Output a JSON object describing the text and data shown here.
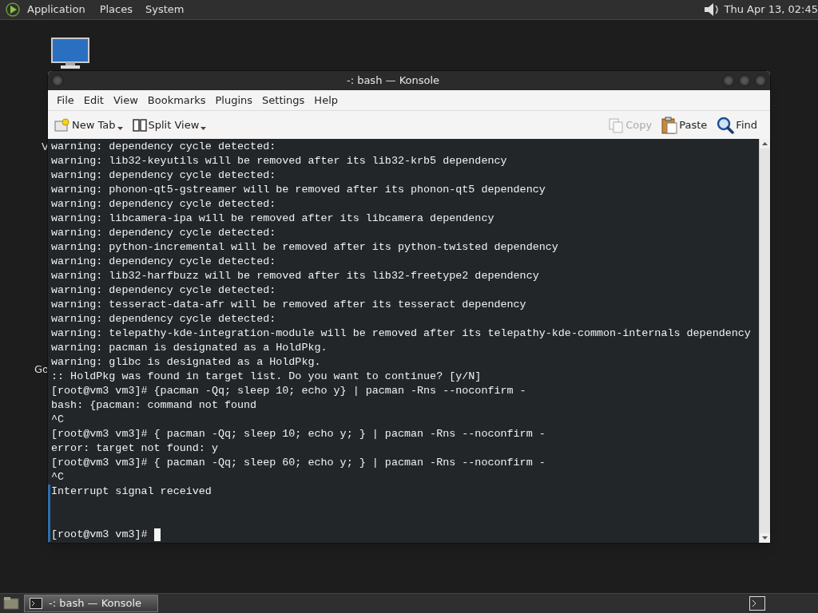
{
  "top_panel": {
    "menus": [
      "Application",
      "Places",
      "System"
    ],
    "clock": "Thu Apr 13, 02:45"
  },
  "desktop_icons": [
    {
      "label": "V"
    },
    {
      "label": "Go"
    }
  ],
  "window": {
    "title": "-: bash — Konsole",
    "menu": [
      "File",
      "Edit",
      "View",
      "Bookmarks",
      "Plugins",
      "Settings",
      "Help"
    ],
    "toolbar": [
      {
        "kind": "newtab",
        "label": "New Tab",
        "dropdown": true,
        "disabled": false
      },
      {
        "kind": "split",
        "label": "Split View",
        "dropdown": true,
        "disabled": false
      },
      {
        "kind": "copy",
        "label": "Copy",
        "dropdown": false,
        "disabled": true
      },
      {
        "kind": "paste",
        "label": "Paste",
        "dropdown": false,
        "disabled": false
      },
      {
        "kind": "find",
        "label": "Find",
        "dropdown": false,
        "disabled": false
      }
    ],
    "terminal_lines": [
      {
        "text": "warning: dependency cycle detected:",
        "marked": false
      },
      {
        "text": "warning: lib32-keyutils will be removed after its lib32-krb5 dependency",
        "marked": false
      },
      {
        "text": "warning: dependency cycle detected:",
        "marked": false
      },
      {
        "text": "warning: phonon-qt5-gstreamer will be removed after its phonon-qt5 dependency",
        "marked": false
      },
      {
        "text": "warning: dependency cycle detected:",
        "marked": false
      },
      {
        "text": "warning: libcamera-ipa will be removed after its libcamera dependency",
        "marked": false
      },
      {
        "text": "warning: dependency cycle detected:",
        "marked": false
      },
      {
        "text": "warning: python-incremental will be removed after its python-twisted dependency",
        "marked": false
      },
      {
        "text": "warning: dependency cycle detected:",
        "marked": false
      },
      {
        "text": "warning: lib32-harfbuzz will be removed after its lib32-freetype2 dependency",
        "marked": false
      },
      {
        "text": "warning: dependency cycle detected:",
        "marked": false
      },
      {
        "text": "warning: tesseract-data-afr will be removed after its tesseract dependency",
        "marked": false
      },
      {
        "text": "warning: dependency cycle detected:",
        "marked": false
      },
      {
        "text": "warning: telepathy-kde-integration-module will be removed after its telepathy-kde-common-internals dependency",
        "marked": false
      },
      {
        "text": "warning: pacman is designated as a HoldPkg.",
        "marked": false
      },
      {
        "text": "warning: glibc is designated as a HoldPkg.",
        "marked": false
      },
      {
        "text": ":: HoldPkg was found in target list. Do you want to continue? [y/N]",
        "marked": false
      },
      {
        "text": "[root@vm3 vm3]# {pacman -Qq; sleep 10; echo y} | pacman -Rns --noconfirm -",
        "marked": false
      },
      {
        "text": "bash: {pacman: command not found",
        "marked": false
      },
      {
        "text": "^C",
        "marked": false
      },
      {
        "text": "[root@vm3 vm3]# { pacman -Qq; sleep 10; echo y; } | pacman -Rns --noconfirm -",
        "marked": false
      },
      {
        "text": "error: target not found: y",
        "marked": false
      },
      {
        "text": "[root@vm3 vm3]# { pacman -Qq; sleep 60; echo y; } | pacman -Rns --noconfirm -",
        "marked": false
      },
      {
        "text": "^C",
        "marked": false
      },
      {
        "text": "Interrupt signal received",
        "marked": true
      },
      {
        "marked": true
      },
      {
        "marked": true
      },
      {
        "text": "[root@vm3 vm3]#",
        "marked": true,
        "cursor": true
      }
    ]
  },
  "taskbar": {
    "tasks": [
      {
        "label": "-: bash — Konsole",
        "selected": true
      }
    ]
  }
}
